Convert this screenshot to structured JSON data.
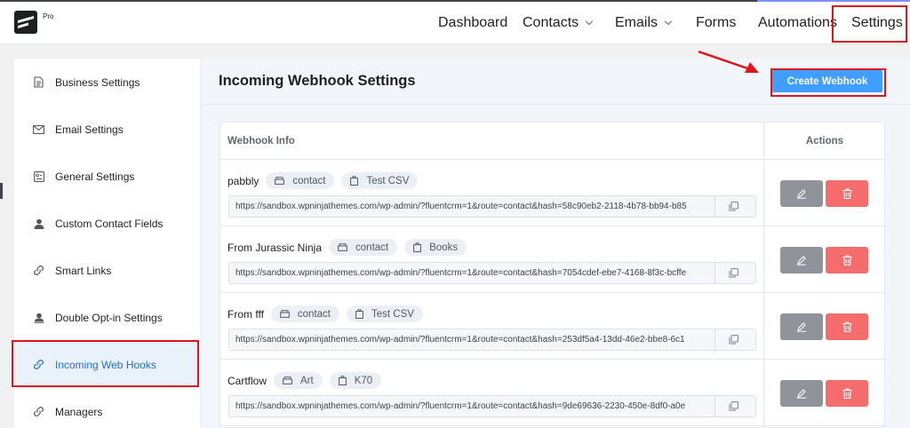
{
  "brand": {
    "badge": "Pro"
  },
  "nav": {
    "items": [
      {
        "label": "Dashboard",
        "has_dropdown": false
      },
      {
        "label": "Contacts",
        "has_dropdown": true
      },
      {
        "label": "Emails",
        "has_dropdown": true
      },
      {
        "label": "Forms",
        "has_dropdown": false
      },
      {
        "label": "Automations",
        "has_dropdown": false
      },
      {
        "label": "Settings",
        "has_dropdown": false
      }
    ]
  },
  "sidebar": {
    "items": [
      {
        "label": "Business Settings",
        "icon": "document-icon"
      },
      {
        "label": "Email Settings",
        "icon": "envelope-icon"
      },
      {
        "label": "General Settings",
        "icon": "settings-card-icon"
      },
      {
        "label": "Custom Contact Fields",
        "icon": "user-icon"
      },
      {
        "label": "Smart Links",
        "icon": "link-icon"
      },
      {
        "label": "Double Opt-in Settings",
        "icon": "user-check-icon"
      },
      {
        "label": "Incoming Web Hooks",
        "icon": "link-icon",
        "active": true
      },
      {
        "label": "Managers",
        "icon": "link-icon"
      }
    ]
  },
  "main": {
    "title": "Incoming Webhook Settings",
    "create_button": "Create Webhook",
    "table": {
      "headers": {
        "info": "Webhook Info",
        "actions": "Actions"
      },
      "rows": [
        {
          "name": "pabbly",
          "list": "contact",
          "tag": "Test CSV",
          "url": "https://sandbox.wpninjathemes.com/wp-admin/?fluentcrm=1&route=contact&hash=58c90eb2-2118-4b78-bb94-b85"
        },
        {
          "name": "From Jurassic Ninja",
          "list": "contact",
          "tag": "Books",
          "url": "https://sandbox.wpninjathemes.com/wp-admin/?fluentcrm=1&route=contact&hash=7054cdef-ebe7-4168-8f3c-bcffe"
        },
        {
          "name": "From fff",
          "list": "contact",
          "tag": "Test CSV",
          "url": "https://sandbox.wpninjathemes.com/wp-admin/?fluentcrm=1&route=contact&hash=253df5a4-13dd-46e2-bbe8-6c1"
        },
        {
          "name": "Cartflow",
          "list": "Art",
          "tag": "K70",
          "url": "https://sandbox.wpninjathemes.com/wp-admin/?fluentcrm=1&route=contact&hash=9de69636-2230-450e-8df0-a0e"
        }
      ]
    }
  },
  "colors": {
    "primary": "#409eff",
    "danger": "#f56c6c",
    "edit": "#909399",
    "annotation": "#e0141b",
    "active_text": "#1f6fd1"
  }
}
